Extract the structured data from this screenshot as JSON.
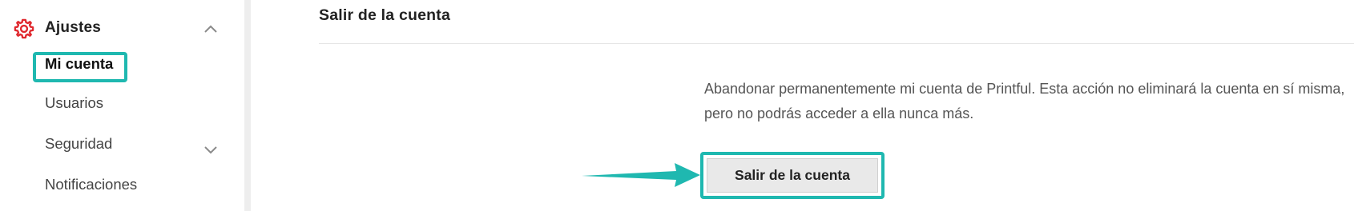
{
  "sidebar": {
    "section": {
      "icon": "gear-icon",
      "title": "Ajustes",
      "toggle_icon": "chevron-up-icon"
    },
    "items": [
      {
        "label": "Mi cuenta",
        "active": true
      },
      {
        "label": "Usuarios"
      },
      {
        "label": "Seguridad",
        "toggle_icon": "chevron-down-icon"
      },
      {
        "label": "Notificaciones"
      }
    ]
  },
  "main": {
    "section_title": "Salir de la cuenta",
    "description": "Abandonar permanentemente mi cuenta de Printful. Esta acción no eliminará la cuenta en sí misma, pero no podrás acceder a ella nunca más.",
    "action_button_label": "Salir de la cuenta"
  },
  "annotations": {
    "pointer_icon": "arrow-right-icon"
  },
  "colors": {
    "highlight": "#1fb8b0",
    "gear_icon": "#e0282e",
    "button_bg": "#e9e9e9",
    "text": "#222222",
    "muted_text": "#555555"
  }
}
